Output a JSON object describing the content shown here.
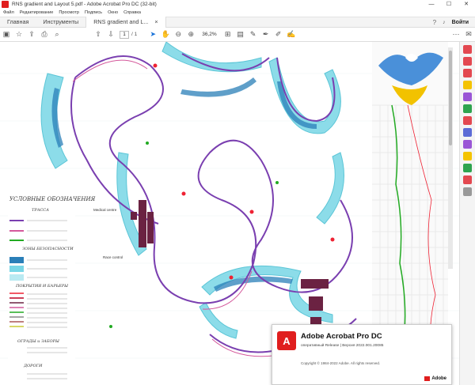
{
  "window": {
    "title": "RNS gradient and Layout 5.pdf - Adobe Acrobat Pro DC (32-bit)",
    "controls": [
      "—",
      "☐",
      "✕"
    ]
  },
  "menu": [
    "Файл",
    "Редактирование",
    "Просмотр",
    "Подпись",
    "Окно",
    "Справка"
  ],
  "tabs": {
    "home": "Главная",
    "tools": "Инструменты",
    "document": "RNS gradient and L...",
    "document_close": "×",
    "signin": "Войти"
  },
  "toolbar": {
    "page_current": "1",
    "page_total": "/ 1",
    "zoom": "36,2%"
  },
  "drawing": {
    "legend_title": "УСЛОВНЫЕ ОБОЗНАЧЕНИЯ",
    "sections": [
      "ТРАССА",
      "ЗОНЫ БЕЗОПАСНОСТИ",
      "ПОКРЫТИЯ И БАРЬЕРЫ",
      "ОГРАДЫ и ЗАБОРЫ",
      "ДОРОГИ"
    ],
    "labels": [
      "Medical centre",
      "Race control"
    ]
  },
  "splash": {
    "product": "Adobe Acrobat Pro DC",
    "version": "оперативный Release | Версия 2022.001.20085",
    "copyright": "Copyright © 1984-2022 Adobe. All rights reserved.",
    "brand": "Adobe"
  },
  "colors": {
    "acrobat_red": "#e01e1e",
    "accent_blue": "#1a73d9",
    "track_purple": "#7a3fb0",
    "safety_cyan": "#3fbcd0"
  }
}
